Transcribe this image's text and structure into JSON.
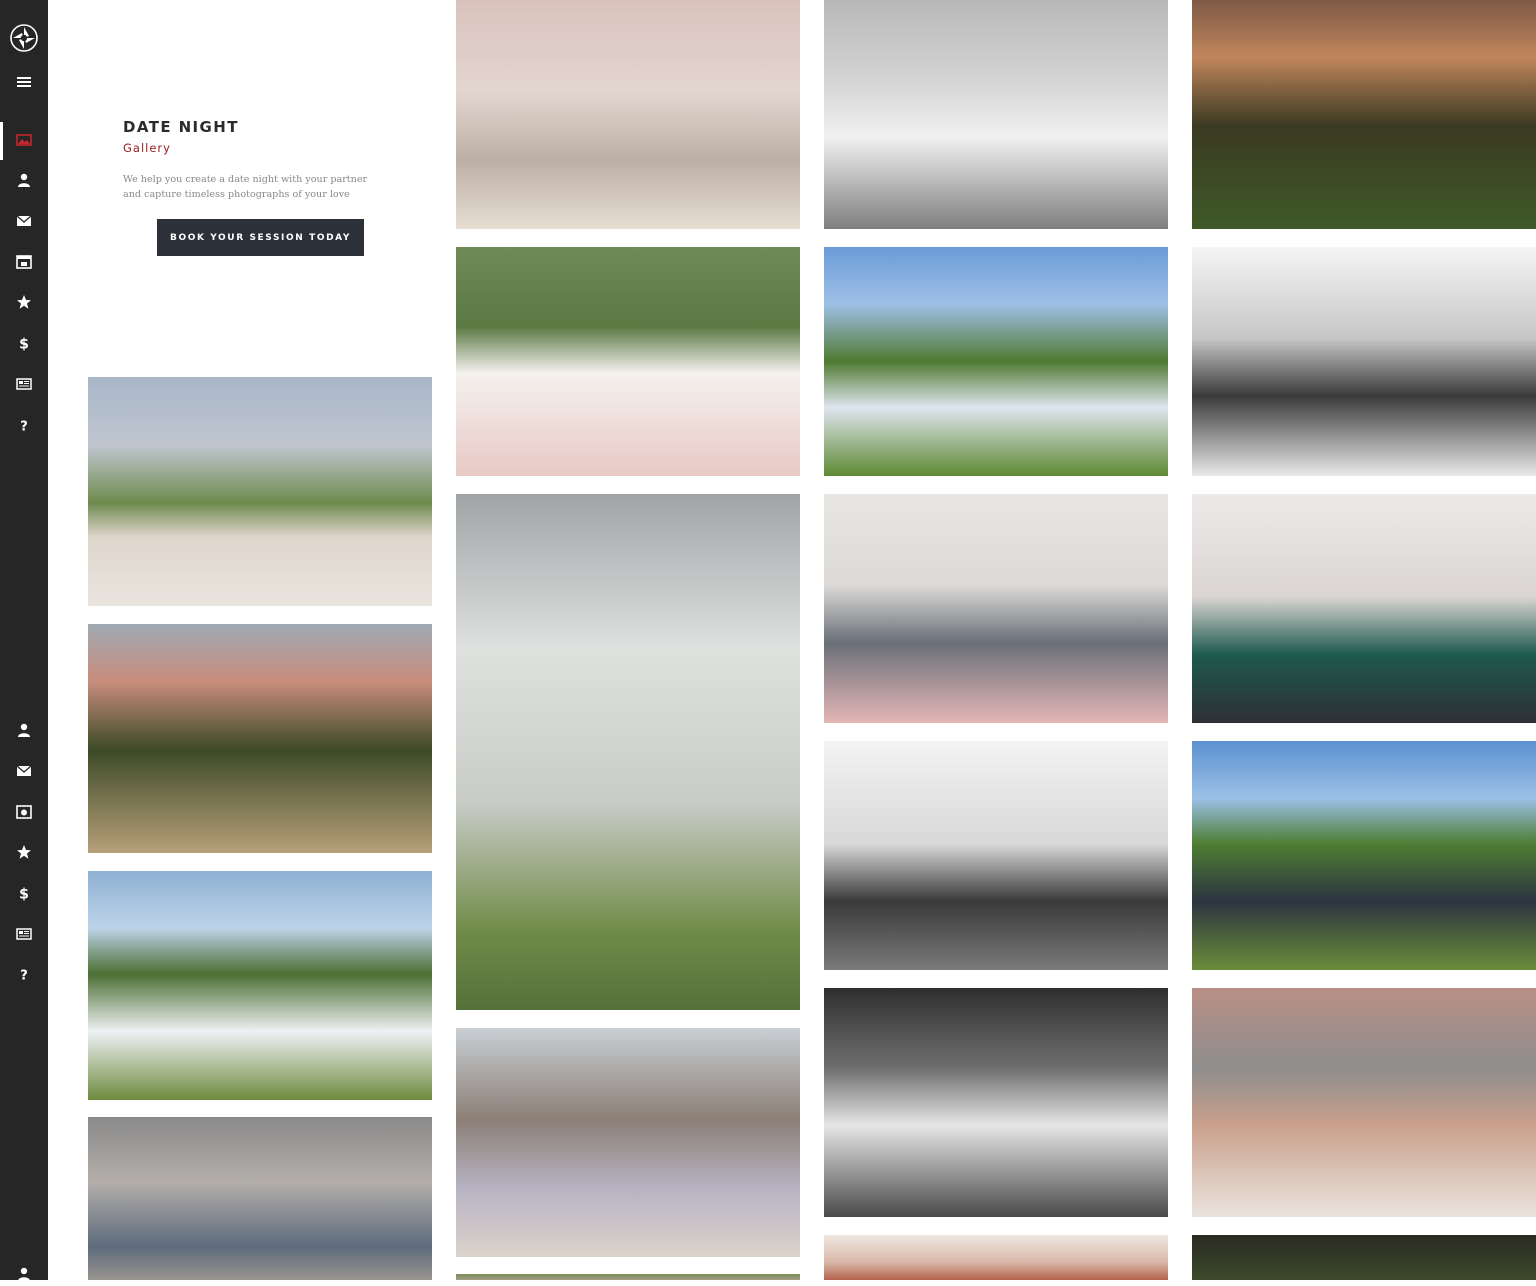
{
  "sidebar": {
    "logo_icon": "aperture-logo-icon",
    "top_icons": [
      "menu-icon",
      "gallery-icon",
      "user-icon",
      "mail-icon",
      "calendar-icon",
      "star-icon",
      "dollar-icon",
      "newspaper-icon",
      "question-icon"
    ],
    "bottom_icons": [
      "user-icon",
      "mail-icon",
      "camera-icon",
      "star-icon",
      "dollar-icon",
      "newspaper-icon",
      "question-icon",
      "user-icon"
    ],
    "active_color": "#c2272d"
  },
  "intro": {
    "title": "DATE NIGHT",
    "subtitle": "Gallery",
    "description": "We help you create a date night with your partner and capture timeless photographs of your love",
    "cta_label": "BOOK YOUR SESSION TODAY"
  },
  "gallery": {
    "photos": [
      {
        "col": 0,
        "desc": "couple-picnic-field",
        "bg": "linear-gradient(180deg,#a9b6c8 0%,#bfc6cf 30%,#6f8a4e 55%,#dfd6cc 70%,#e9e4de 100%)"
      },
      {
        "col": 0,
        "desc": "couple-field-sunset",
        "bg": "linear-gradient(180deg,#9fa9b3 0%,#c98d7c 25%,#3d4a27 55%,#b7a07a 100%)"
      },
      {
        "col": 0,
        "desc": "couple-lake-barn",
        "bg": "linear-gradient(180deg,#8fb1d3 0%,#bcd3e8 25%,#4c6f33 45%,#eef1f4 70%,#6d8b3e 100%)"
      },
      {
        "col": 0,
        "desc": "couple-smoke-dip",
        "bg": "linear-gradient(180deg,#8a8a8a 0%,#b3aeaa 40%,#5d6b7c 80%,#9a9590 100%)"
      },
      {
        "col": 1,
        "desc": "couple-pier-beach",
        "bg": "linear-gradient(180deg,#d9c2bd 0%,#e3d6cf 40%,#bcb0a6 70%,#e7ddd3 100%)"
      },
      {
        "col": 1,
        "desc": "couple-rocking-chairs",
        "bg": "linear-gradient(180deg,#6e8a58 0%,#5c7a44 35%,#f4f1ee 55%,#e8c9c5 100%)"
      },
      {
        "col": 1,
        "desc": "couple-barn-cowboy-hats",
        "bg": "linear-gradient(180deg,#a0a4a6 0%,#dfe1df 30%,#c8ccc6 60%,#6f8a47 85%,#55713a 100%)"
      },
      {
        "col": 1,
        "desc": "couple-beach-rocks",
        "bg": "linear-gradient(180deg,#c9cfd4 0%,#8b7f76 40%,#b7b3c3 70%,#dcd3cb 100%)"
      },
      {
        "col": 2,
        "desc": "couple-bw-kiss-park",
        "bg": "linear-gradient(180deg,#b8b8b8 0%,#d4d4d4 35%,#f1f1f1 60%,#7e7e7e 100%)"
      },
      {
        "col": 2,
        "desc": "couple-soldier-dip-lake",
        "bg": "linear-gradient(180deg,#6a9bd8 0%,#9fc0e6 25%,#4f7a31 50%,#dfe5ef 70%,#5e8a33 100%)"
      },
      {
        "col": 2,
        "desc": "couple-living-room-clock",
        "bg": "linear-gradient(180deg,#e8e6e3 0%,#dcd9d6 40%,#6a6f78 65%,#e4b6b6 100%)"
      },
      {
        "col": 2,
        "desc": "couple-bw-window-gown",
        "bg": "linear-gradient(180deg,#f3f3f3 0%,#d8d8d8 45%,#3a3a3a 70%,#7a7a7a 100%)"
      },
      {
        "col": 2,
        "desc": "couple-bw-forest-smile",
        "bg": "linear-gradient(180deg,#2e2e2e 0%,#6f6f6f 35%,#e6e6e6 60%,#4a4a4a 100%)"
      },
      {
        "col": 3,
        "desc": "couple-umbrella-sunset",
        "bg": "linear-gradient(180deg,#7d5a46 0%,#c0865c 25%,#3b3a22 55%,#3f5a28 100%)"
      },
      {
        "col": 3,
        "desc": "couple-bw-bed",
        "bg": "linear-gradient(180deg,#f5f5f5 0%,#c6c6c6 40%,#3a3a3a 65%,#e9e9e9 100%)"
      },
      {
        "col": 3,
        "desc": "couple-studio-green-dress",
        "bg": "linear-gradient(180deg,#ece9e8 0%,#dad5d3 45%,#1e5a4e 70%,#2e2f35 100%)"
      },
      {
        "col": 3,
        "desc": "couple-soldier-lake",
        "bg": "linear-gradient(180deg,#5c90d0 0%,#9bc0e6 25%,#4e7e34 45%,#2c3440 70%,#6b8d3a 100%)"
      },
      {
        "col": 3,
        "desc": "couple-cozy-blanket",
        "bg": "linear-gradient(180deg,#b98f86 0%,#8e8e8c 35%,#caa08c 60%,#eae4de 100%)"
      },
      {
        "col": 1,
        "desc": "photo-partial-bottom",
        "bg": "linear-gradient(180deg,#7b8b57 0%,#a4a084 100%)"
      },
      {
        "col": 2,
        "desc": "photo-partial-bottom",
        "bg": "linear-gradient(180deg,#f0e8e2 0%,#d9b8a8 60%,#b4634e 100%)"
      },
      {
        "col": 3,
        "desc": "photo-partial-bottom",
        "bg": "linear-gradient(180deg,#2a2a22 0%,#3c4a2a 100%)"
      }
    ]
  }
}
